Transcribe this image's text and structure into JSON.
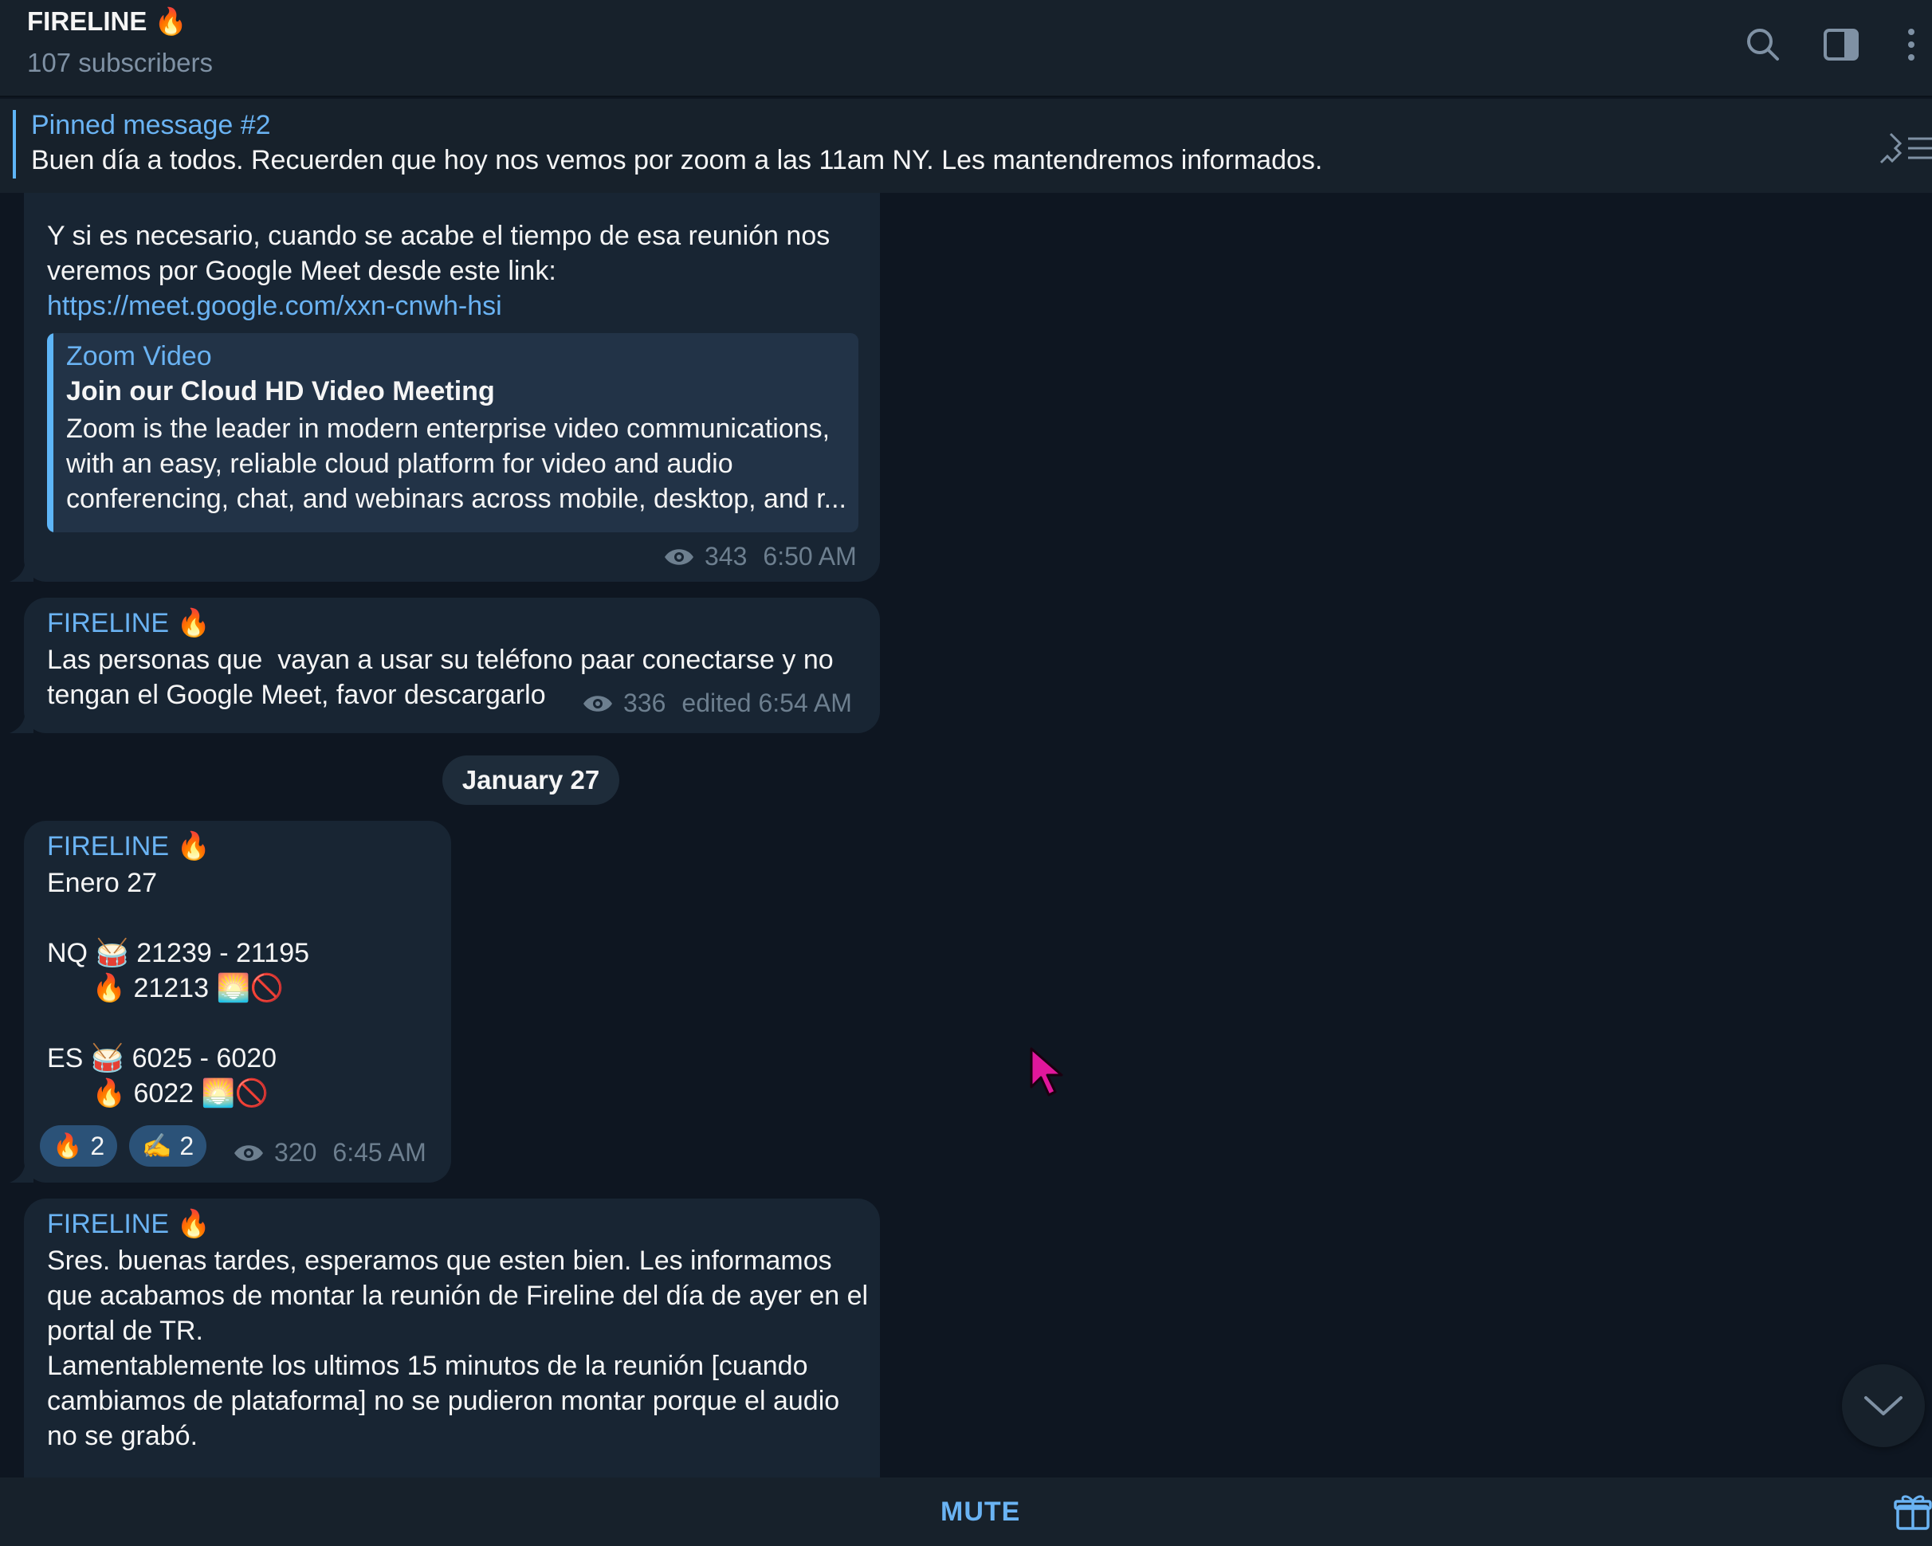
{
  "header": {
    "title": "FIRELINE 🔥",
    "subtitle": "107 subscribers",
    "icons": [
      "search-icon",
      "sidebar-toggle-icon",
      "more-vertical-icon"
    ]
  },
  "pinned": {
    "title": "Pinned message #2",
    "text": "Buen día a todos. Recuerden que hoy nos vemos por zoom a las 11am NY. Les mantendremos informados."
  },
  "messages": [
    {
      "text_lines": "Y si es necesario, cuando se acabe el tiempo de esa reunión nos\nveremos por Google Meet desde este link:",
      "link": "https://meet.google.com/xxn-cnwh-hsi",
      "preview": {
        "site": "Zoom Video",
        "title": "Join our Cloud HD Video Meeting",
        "description": "Zoom is the leader in modern enterprise video communications,\nwith an easy, reliable cloud platform for video and audio\nconferencing, chat, and webinars across mobile, desktop, and r..."
      },
      "views": "343",
      "time": "6:50 AM"
    },
    {
      "sender": "FIRELINE 🔥",
      "text": "Las personas que  vayan a usar su teléfono paar conectarse y no\ntengan el Google Meet, favor descargarlo",
      "views": "336",
      "time": "edited 6:54 AM"
    },
    {
      "sender": "FIRELINE 🔥",
      "text": "Enero 27\n\nNQ 🥁 21239 - 21195\n      🔥 21213 🌅🚫\n\nES 🥁 6025 - 6020\n      🔥 6022 🌅🚫",
      "reactions": [
        {
          "emoji": "🔥",
          "count": "2"
        },
        {
          "emoji": "✍️",
          "count": "2"
        }
      ],
      "views": "320",
      "time": "6:45 AM"
    },
    {
      "sender": "FIRELINE 🔥",
      "text": "Sres. buenas tardes, esperamos que esten bien. Les informamos\nque acabamos de montar la reunión de Fireline del día de ayer en el\nportal de TR.\nLamentablemente los ultimos 15 minutos de la reunión [cuando\ncambiamos de plataforma] no se pudieron montar porque el audio\nno se grabó."
    }
  ],
  "date_separator": "January 27",
  "footer": {
    "mute_label": "MUTE"
  },
  "colors": {
    "background": "#0e1621",
    "panel": "#17212b",
    "bubble": "#182533",
    "accent": "#6ab3f3",
    "muted_text": "#6d7f8f",
    "cursor": "#e0179b"
  }
}
